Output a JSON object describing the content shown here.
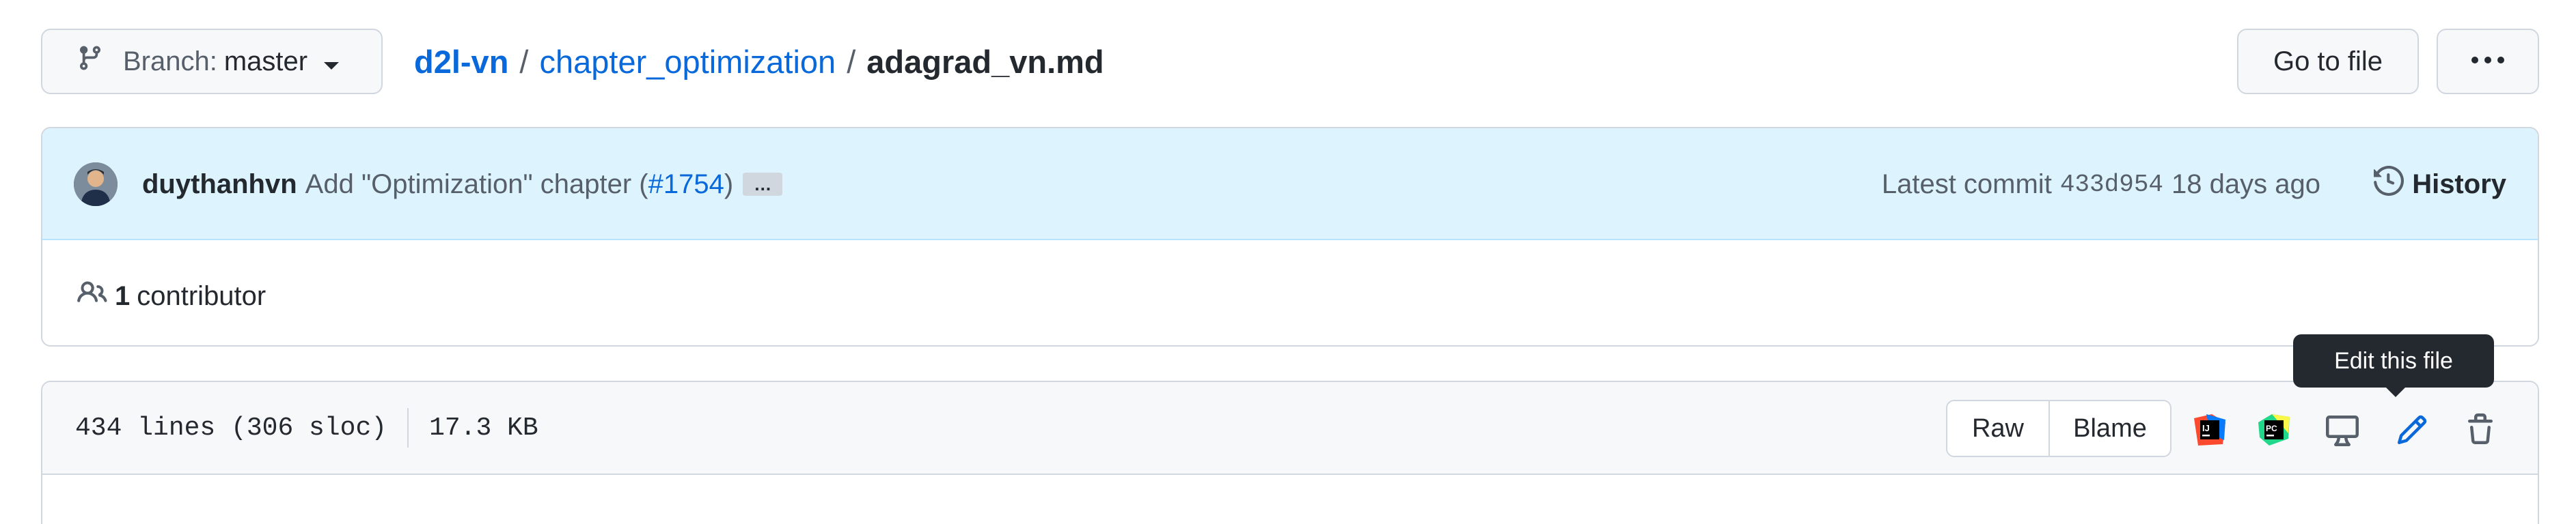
{
  "branch": {
    "label": "Branch:",
    "value": "master"
  },
  "breadcrumb": {
    "repo": "d2l-vn",
    "sep": "/",
    "dir": "chapter_optimization",
    "file": "adagrad_vn.md"
  },
  "header_buttons": {
    "goto_file": "Go to file",
    "more": "more-options-icon"
  },
  "commit": {
    "author": "duythanhvn",
    "message_pre": "Add \"Optimization\" chapter (",
    "pr_link": "#1754",
    "message_post": ")",
    "ellipsis": "…",
    "latest_label": "Latest commit",
    "sha": "433d954",
    "time": "18 days ago",
    "history_label": "History"
  },
  "contributors": {
    "count": "1",
    "label": "contributor"
  },
  "file": {
    "lines": "434 lines (306 sloc)",
    "size": "17.3 KB"
  },
  "file_actions": {
    "raw": "Raw",
    "blame": "Blame",
    "tooltip": "Edit this file",
    "icons": [
      "intellij-icon",
      "pycharm-icon",
      "desktop-icon",
      "pencil-icon",
      "trash-icon"
    ]
  },
  "colors": {
    "link": "#0969da",
    "commit_bg": "#ddf4ff",
    "border": "#d0d7de",
    "text": "#24292f",
    "muted": "#57606a"
  }
}
